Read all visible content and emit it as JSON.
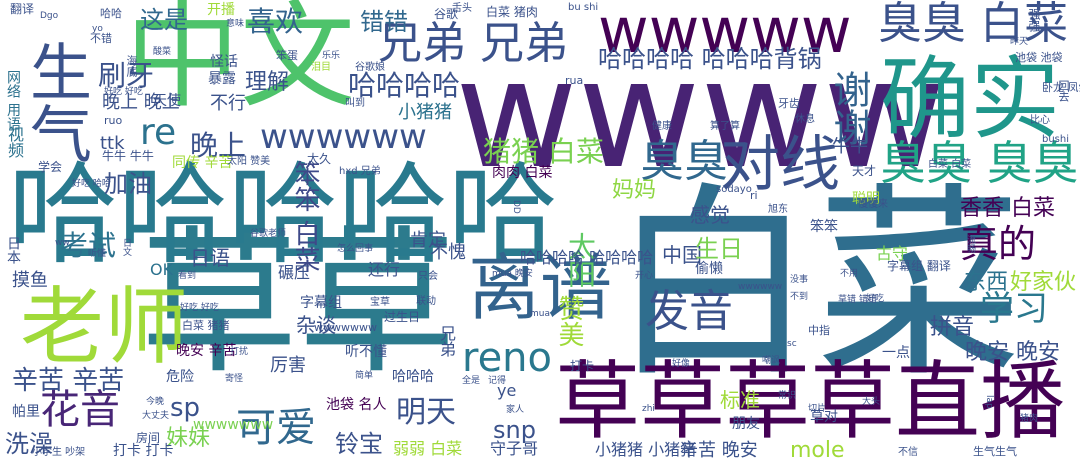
{
  "words": [
    {
      "text": "白菜",
      "color": "#2f6e8e"
    },
    {
      "text": "草草",
      "color": "#2c7b8d"
    },
    {
      "text": "哈哈哈哈哈",
      "color": "#297a8e"
    },
    {
      "text": "wwww",
      "color": "#482374"
    },
    {
      "text": "中文",
      "color": "#4ec36b"
    },
    {
      "text": "老师",
      "color": "#a0da39"
    },
    {
      "text": "草草草草直播",
      "color": "#440154"
    },
    {
      "text": "确实",
      "color": "#1f968b"
    },
    {
      "text": "离谱",
      "color": "#33638d"
    },
    {
      "text": "wwwww",
      "color": "#440154"
    },
    {
      "text": "对线",
      "color": "#3b528b"
    },
    {
      "text": "生气",
      "color": "#3b528b"
    },
    {
      "text": "臭臭 臭臭",
      "color": "#20a386"
    },
    {
      "text": "兄弟 兄弟",
      "color": "#3b528b"
    },
    {
      "text": "臭臭 白菜",
      "color": "#3b528b"
    },
    {
      "text": "臭臭",
      "color": "#31688e"
    },
    {
      "text": "真的",
      "color": "#440154"
    },
    {
      "text": "谢谢",
      "color": "#33638d"
    },
    {
      "text": "reno",
      "color": "#2a788e"
    },
    {
      "text": "发音",
      "color": "#3b528b"
    },
    {
      "text": "花音",
      "color": "#482677"
    },
    {
      "text": "可爱",
      "color": "#31688e"
    },
    {
      "text": "明天",
      "color": "#3b528b"
    },
    {
      "text": "wwwwww",
      "color": "#3b528b"
    },
    {
      "text": "学习",
      "color": "#2a788e"
    },
    {
      "text": "re",
      "color": "#2c728e"
    },
    {
      "text": "哈哈哈哈 哈哈哈背锅",
      "color": "#3b528b"
    },
    {
      "text": "哈哈哈哈",
      "color": "#3b528b"
    },
    {
      "text": "猪猪 白菜",
      "color": "#7ad151"
    },
    {
      "text": "喜欢",
      "color": "#33638d"
    },
    {
      "text": "错错",
      "color": "#31688e"
    },
    {
      "text": "这是",
      "color": "#31688e"
    },
    {
      "text": "刷牙",
      "color": "#3b528b"
    },
    {
      "text": "晚上",
      "color": "#3b528b"
    },
    {
      "text": "考试",
      "color": "#2c728e"
    },
    {
      "text": "加油",
      "color": "#3b528b"
    },
    {
      "text": "笨笨 白菜",
      "color": "#3e4989"
    },
    {
      "text": "太阳",
      "color": "#5ec962"
    },
    {
      "text": "赞美",
      "color": "#a0da39"
    },
    {
      "text": "中国",
      "color": "#3b528b"
    },
    {
      "text": "生日",
      "color": "#7ad151"
    },
    {
      "text": "妈妈",
      "color": "#8fd744"
    },
    {
      "text": "感觉",
      "color": "#3b528b"
    },
    {
      "text": "香香 白菜",
      "color": "#440154"
    },
    {
      "text": "东西",
      "color": "#2c728e"
    },
    {
      "text": "好家伙",
      "color": "#a0da39"
    },
    {
      "text": "拼音",
      "color": "#3b528b"
    },
    {
      "text": "晚安 晚安",
      "color": "#3b528b"
    },
    {
      "text": "辛苦 辛苦",
      "color": "#3b528b"
    },
    {
      "text": "sp",
      "color": "#3b528b"
    },
    {
      "text": "妹妹",
      "color": "#7ad151"
    },
    {
      "text": "洗澡",
      "color": "#3b528b"
    },
    {
      "text": "铃宝",
      "color": "#3b528b"
    },
    {
      "text": "snp",
      "color": "#3b528b"
    },
    {
      "text": "mole",
      "color": "#a0da39"
    },
    {
      "text": "辛苦 晚安",
      "color": "#3b528b"
    },
    {
      "text": "标准",
      "color": "#a0da39"
    },
    {
      "text": "杂谈",
      "color": "#3b528b"
    },
    {
      "text": "肯定",
      "color": "#3b528b"
    },
    {
      "text": "日语",
      "color": "#3b528b"
    },
    {
      "text": "不愧",
      "color": "#3b528b"
    },
    {
      "text": "摸鱼",
      "color": "#3b528b"
    },
    {
      "text": "理解",
      "color": "#3b528b"
    },
    {
      "text": "不行",
      "color": "#3b528b"
    },
    {
      "text": "小猪猪",
      "color": "#2c728e"
    },
    {
      "text": "晚上 晚上",
      "color": "#3b528b"
    },
    {
      "text": "ttk",
      "color": "#3b528b"
    },
    {
      "text": "牛牛",
      "color": "#3b528b"
    },
    {
      "text": "肉肉 白菜",
      "color": "#440154"
    },
    {
      "text": "同传 辛苦",
      "color": "#a0da39"
    },
    {
      "text": "天使",
      "color": "#3b528b"
    },
    {
      "text": "怪话",
      "color": "#3b528b"
    },
    {
      "text": "暴露",
      "color": "#3b528b"
    },
    {
      "text": "开播",
      "color": "#a0da39"
    },
    {
      "text": "谷歌",
      "color": "#3b528b"
    },
    {
      "text": "白菜 猪肉",
      "color": "#3b528b"
    },
    {
      "text": "视频",
      "color": "#2c728e"
    },
    {
      "text": "网络 用语",
      "color": "#2c728e"
    },
    {
      "text": "OK",
      "color": "#2c728e"
    },
    {
      "text": "碾压",
      "color": "#3b528b"
    },
    {
      "text": "还行",
      "color": "#3b528b"
    },
    {
      "text": "字幕组",
      "color": "#3b528b"
    },
    {
      "text": "危险",
      "color": "#3b528b"
    },
    {
      "text": "厉害",
      "color": "#3b528b"
    },
    {
      "text": "帕里",
      "color": "#3b528b"
    },
    {
      "text": "房间",
      "color": "#3b528b"
    },
    {
      "text": "打卡",
      "color": "#3b528b"
    },
    {
      "text": "一点",
      "color": "#3b528b"
    },
    {
      "text": "草对",
      "color": "#3b528b"
    },
    {
      "text": "偷懒",
      "color": "#3b528b"
    },
    {
      "text": "古守",
      "color": "#3b528b"
    },
    {
      "text": "笨笨",
      "color": "#7ad151"
    },
    {
      "text": "聪明",
      "color": "#3b528b"
    },
    {
      "text": "天才",
      "color": "#a0da39"
    },
    {
      "text": "朋友",
      "color": "#3b528b"
    },
    {
      "text": "守子哥",
      "color": "#3b528b"
    },
    {
      "text": "小猪猪 小猪猪",
      "color": "#3b528b"
    },
    {
      "text": "弱弱 白菜",
      "color": "#3b528b"
    },
    {
      "text": "池袋 名人",
      "color": "#a0da39"
    },
    {
      "text": "哈哈哈",
      "color": "#440154"
    },
    {
      "text": "晚安 辛苦",
      "color": "#3b528b"
    },
    {
      "text": "听不懂",
      "color": "#440154"
    },
    {
      "text": "白菜 猪猪",
      "color": "#3b528b"
    },
    {
      "text": "wwwwwww",
      "color": "#3b528b"
    },
    {
      "text": "wwwwwww",
      "color": "#3b528b"
    },
    {
      "text": "生气生气",
      "color": "#7ad151"
    },
    {
      "text": "哈哈哈哈 哈哈哈哈",
      "color": "#3b528b"
    },
    {
      "text": "兄弟",
      "color": "#3b528b"
    },
    {
      "text": "日本",
      "color": "#3b528b"
    },
    {
      "text": "翻译",
      "color": "#3b528b"
    },
    {
      "text": "海底",
      "color": "#3b528b"
    },
    {
      "text": "牛牛 牛牛",
      "color": "#3b528b"
    },
    {
      "text": "学会",
      "color": "#3b528b"
    },
    {
      "text": "不错",
      "color": "#3b528b"
    },
    {
      "text": "笨蛋",
      "color": "#3b528b"
    },
    {
      "text": "舌头",
      "color": "#3b528b"
    },
    {
      "text": "bu shi",
      "color": "#3b528b"
    },
    {
      "text": "强强",
      "color": "#3b528b"
    },
    {
      "text": "池袋 池袋",
      "color": "#3b528b"
    },
    {
      "text": "卧龙 凤雏",
      "color": "#3b528b"
    },
    {
      "text": "比心",
      "color": "#3b528b"
    },
    {
      "text": "bushi",
      "color": "#3b528b"
    },
    {
      "text": "回去",
      "color": "#3b528b"
    },
    {
      "text": "白菜 白菜",
      "color": "#3b528b"
    },
    {
      "text": "慢慢来",
      "color": "#3b528b"
    },
    {
      "text": "sodayo",
      "color": "#3b528b"
    },
    {
      "text": "旭东",
      "color": "#3b528b"
    },
    {
      "text": "休息",
      "color": "#3b528b"
    },
    {
      "text": "算了算",
      "color": "#3b528b"
    },
    {
      "text": "健康",
      "color": "#3b528b"
    },
    {
      "text": "牙齿",
      "color": "#3b528b"
    },
    {
      "text": "叫到",
      "color": "#3b528b"
    },
    {
      "text": "谷歌娘",
      "color": "#3b528b"
    },
    {
      "text": "泪目",
      "color": "#3b528b"
    },
    {
      "text": "太久",
      "color": "#3b528b"
    },
    {
      "text": "太阳 赞美",
      "color": "#3b528b"
    },
    {
      "text": "hxd 兄弟",
      "color": "#3b528b"
    },
    {
      "text": "只会",
      "color": "#3b528b"
    },
    {
      "text": "宝草",
      "color": "#3b528b"
    },
    {
      "text": "联动",
      "color": "#3b528b"
    },
    {
      "text": "草错 错错",
      "color": "#3b528b"
    },
    {
      "text": "不到",
      "color": "#3b528b"
    },
    {
      "text": "没事",
      "color": "#3b528b"
    },
    {
      "text": "不用",
      "color": "#3b528b"
    },
    {
      "text": "好吃",
      "color": "#3b528b"
    },
    {
      "text": "流畅",
      "color": "#3b528b"
    },
    {
      "text": "中指",
      "color": "#3b528b"
    },
    {
      "text": "sc",
      "color": "#3b528b"
    },
    {
      "text": "嘲讽",
      "color": "#3b528b"
    },
    {
      "text": "好像",
      "color": "#3b528b"
    },
    {
      "text": "大头",
      "color": "#3b528b"
    },
    {
      "text": "切片",
      "color": "#3b528b"
    },
    {
      "text": "常识",
      "color": "#3b528b"
    },
    {
      "text": "zhi",
      "color": "#3b528b"
    },
    {
      "text": "家人",
      "color": "#3b528b"
    },
    {
      "text": "大丈夫",
      "color": "#3b528b"
    },
    {
      "text": "今晚",
      "color": "#3b528b"
    },
    {
      "text": "寄怪",
      "color": "#3b528b"
    },
    {
      "text": "简单",
      "color": "#3b528b"
    },
    {
      "text": "全是",
      "color": "#3b528b"
    },
    {
      "text": "记得",
      "color": "#3b528b"
    },
    {
      "text": "mua 晚安",
      "color": "#3b528b"
    },
    {
      "text": "开心",
      "color": "#3b528b"
    },
    {
      "text": "小学生 吵架",
      "color": "#3b528b"
    },
    {
      "text": "打卡 打卡",
      "color": "#3b528b"
    },
    {
      "text": "DD",
      "color": "#3b528b"
    },
    {
      "text": "好吃 好吃",
      "color": "#3b528b"
    },
    {
      "text": "看到",
      "color": "#3b528b"
    },
    {
      "text": "怎么回事",
      "color": "#3b528b"
    },
    {
      "text": "谷歌老师",
      "color": "#3b528b"
    },
    {
      "text": "打扰",
      "color": "#3b528b"
    },
    {
      "text": "听懂",
      "color": "#3b528b"
    },
    {
      "text": "日文",
      "color": "#3b528b"
    },
    {
      "text": "过生日",
      "color": "#3b528b"
    },
    {
      "text": "字幕组 翻译",
      "color": "#3b528b"
    },
    {
      "text": "ri",
      "color": "#3b528b"
    },
    {
      "text": "rua",
      "color": "#3b528b"
    },
    {
      "text": "ye",
      "color": "#3b528b"
    },
    {
      "text": "ruo",
      "color": "#3b528b"
    },
    {
      "text": "ww",
      "color": "#3b528b"
    },
    {
      "text": "mua",
      "color": "#3b528b"
    },
    {
      "text": "Dgo",
      "color": "#3b528b"
    },
    {
      "text": "lap",
      "color": "#3b528b"
    },
    {
      "text": "yo",
      "color": "#3b528b"
    },
    {
      "text": "好吃 好吃",
      "color": "#3b528b"
    },
    {
      "text": "乐乐",
      "color": "#3b528b"
    },
    {
      "text": "意味",
      "color": "#3b528b"
    },
    {
      "text": "哈哈",
      "color": "#3b528b"
    },
    {
      "text": "不信",
      "color": "#3b528b"
    },
    {
      "text": "酸菜",
      "color": "#3b528b"
    },
    {
      "text": "wwwwww",
      "color": "#3b528b"
    },
    {
      "text": "昨天",
      "color": "#3b528b"
    },
    {
      "text": "猪肉",
      "color": "#3b528b"
    },
    {
      "text": "好吃 哈哈",
      "color": "#3b528b"
    },
    {
      "text": "哈哈 哈哈",
      "color": "#3b528b"
    },
    {
      "text": "芳姨",
      "color": "#3b528b"
    }
  ]
}
